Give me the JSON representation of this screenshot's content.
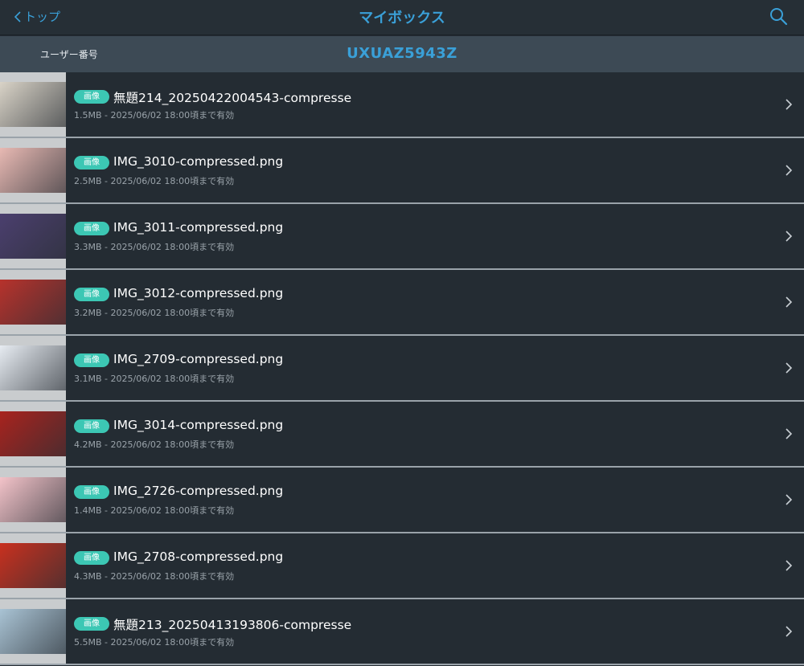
{
  "nav": {
    "back_label": "トップ",
    "title": "マイボックス",
    "search_icon": "search-icon",
    "accent_color": "#3aa0d8"
  },
  "user": {
    "label": "ユーザー番号",
    "id": "UXUAZ5943Z"
  },
  "items": [
    {
      "badge": "画像",
      "filename": "無題214_20250422004543-compresse",
      "meta": "1.5MB - 2025/06/02 18:00頃まで有効",
      "thumb_color": "#d9d3c7"
    },
    {
      "badge": "画像",
      "filename": "IMG_3010-compressed.png",
      "meta": "2.5MB - 2025/06/02 18:00頃まで有効",
      "thumb_color": "#e8b9b3"
    },
    {
      "badge": "画像",
      "filename": "IMG_3011-compressed.png",
      "meta": "3.3MB - 2025/06/02 18:00頃まで有効",
      "thumb_color": "#4b3f6e"
    },
    {
      "badge": "画像",
      "filename": "IMG_3012-compressed.png",
      "meta": "3.2MB - 2025/06/02 18:00頃まで有効",
      "thumb_color": "#b7322c"
    },
    {
      "badge": "画像",
      "filename": "IMG_2709-compressed.png",
      "meta": "3.1MB - 2025/06/02 18:00頃まで有効",
      "thumb_color": "#e7ecf2"
    },
    {
      "badge": "画像",
      "filename": "IMG_3014-compressed.png",
      "meta": "4.2MB - 2025/06/02 18:00頃まで有効",
      "thumb_color": "#a8231e"
    },
    {
      "badge": "画像",
      "filename": "IMG_2726-compressed.png",
      "meta": "1.4MB - 2025/06/02 18:00頃まで有効",
      "thumb_color": "#f3c3c9"
    },
    {
      "badge": "画像",
      "filename": "IMG_2708-compressed.png",
      "meta": "4.3MB - 2025/06/02 18:00頃まで有効",
      "thumb_color": "#c8301f"
    },
    {
      "badge": "画像",
      "filename": "無題213_20250413193806-compresse",
      "meta": "5.5MB - 2025/06/02 18:00頃まで有効",
      "thumb_color": "#a9c3d4"
    }
  ],
  "colors": {
    "background": "#242c33",
    "userbar": "#3d4a55",
    "badge": "#3cc7b4",
    "separator": "#9aa3aa"
  }
}
